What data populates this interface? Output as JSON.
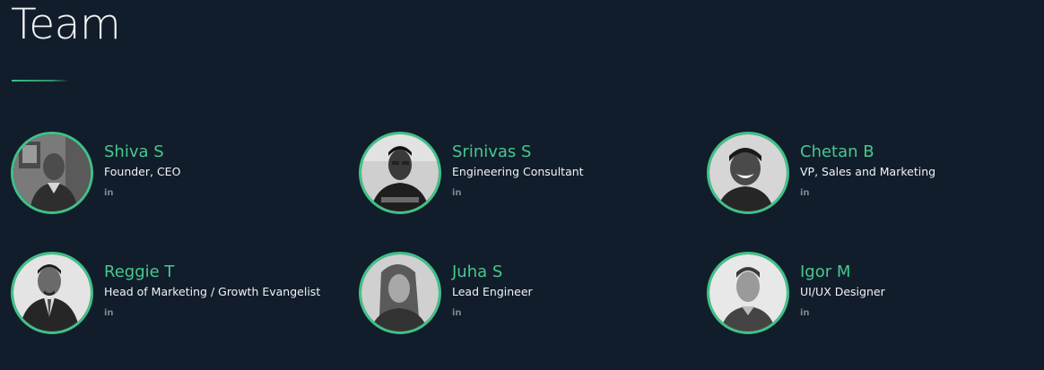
{
  "section": {
    "title": "Team"
  },
  "members": [
    {
      "name": "Shiva S",
      "role": "Founder, CEO",
      "social": "in",
      "photo_icon": "person-photo-icon"
    },
    {
      "name": "Srinivas S",
      "role": "Engineering Consultant",
      "social": "in",
      "photo_icon": "person-photo-icon"
    },
    {
      "name": "Chetan B",
      "role": "VP, Sales and Marketing",
      "social": "in",
      "photo_icon": "person-photo-icon"
    },
    {
      "name": "Reggie T",
      "role": "Head of Marketing / Growth Evangelist",
      "social": "in",
      "photo_icon": "person-photo-icon"
    },
    {
      "name": "Juha S",
      "role": "Lead Engineer",
      "social": "in",
      "photo_icon": "person-photo-icon"
    },
    {
      "name": "Igor M",
      "role": "UI/UX Designer",
      "social": "in",
      "photo_icon": "person-photo-icon"
    }
  ],
  "colors": {
    "background": "#121d2b",
    "accent": "#46c98d",
    "ring": "#3fc287",
    "text": "#f0f3f6",
    "muted": "#7d8794"
  }
}
